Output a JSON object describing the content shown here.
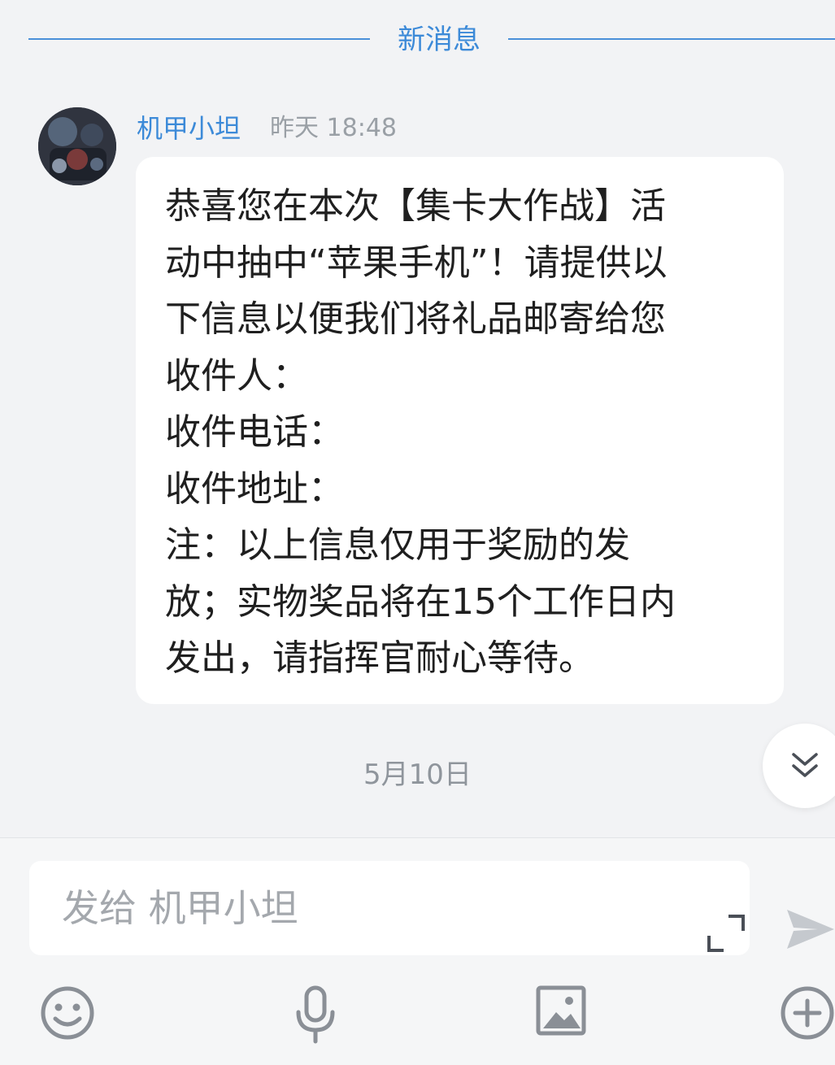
{
  "divider": {
    "label": "新消息"
  },
  "message": {
    "sender": "机甲小坦",
    "timestamp": "昨天 18:48",
    "lines": [
      "恭喜您在本次【集卡大作战】活",
      "动中抽中“苹果手机”！请提供以",
      "下信息以便我们将礼品邮寄给您",
      "收件人：",
      "收件电话：",
      "收件地址：",
      "注：以上信息仅用于奖励的发",
      "放；实物奖品将在15个工作日内",
      "发出，请指挥官耐心等待。"
    ]
  },
  "date_separator": "5月10日",
  "composer": {
    "placeholder": "发给 机甲小坦"
  },
  "icons": {
    "scroll_down": "double-chevron-down-icon",
    "expand": "expand-icon",
    "send": "send-icon",
    "emoji": "emoji-icon",
    "voice": "microphone-icon",
    "image": "image-icon",
    "more": "plus-circle-icon"
  },
  "colors": {
    "accent": "#3c8ad8",
    "bubble": "#ffffff",
    "background": "#f2f3f5",
    "icon_gray": "#8a8f96"
  }
}
